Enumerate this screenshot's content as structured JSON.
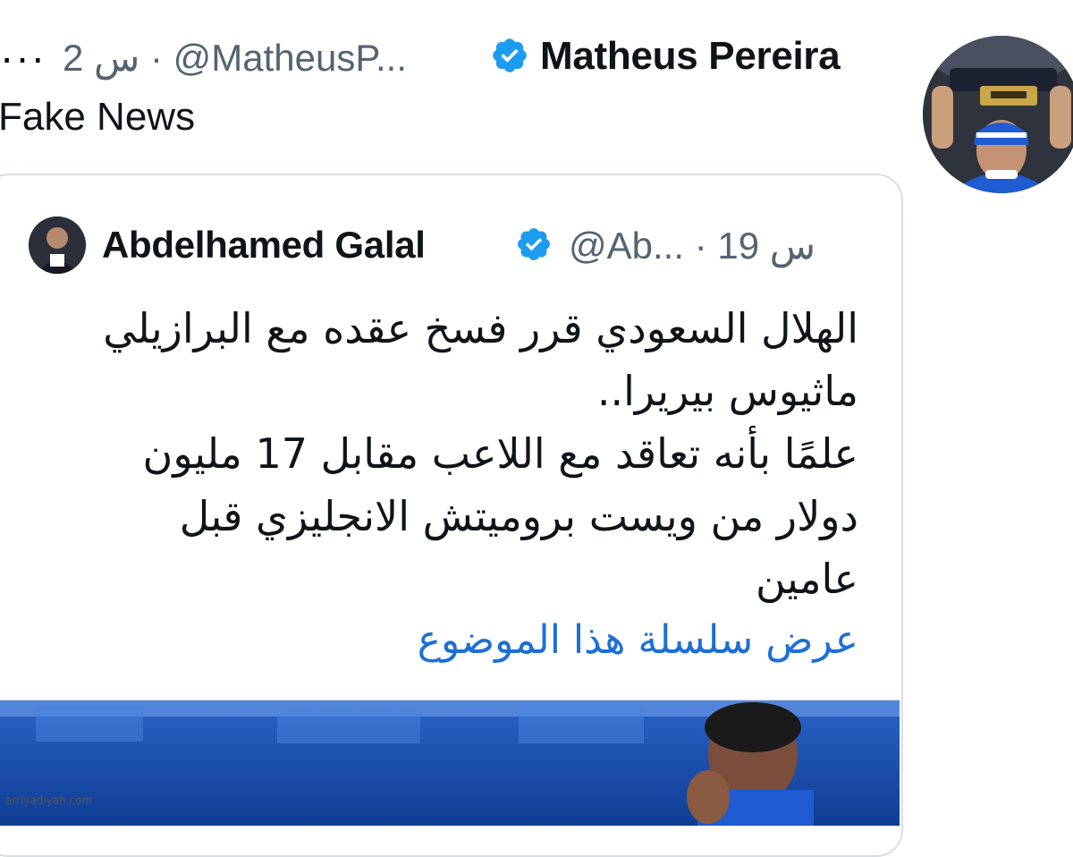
{
  "tweet": {
    "more_label": "···",
    "time_label": "2 س",
    "separator": "·",
    "handle": "@MatheusP...",
    "author_name": "Matheus Pereira",
    "text": "Fake News"
  },
  "quoted_tweet": {
    "author_name": "Abdelhamed Galal",
    "handle": "@Ab...",
    "separator": "·",
    "time_label": "19 س",
    "lines": [
      "الهلال السعودي قرر فسخ عقده مع البرازيلي",
      "ماثيوس بيريرا..",
      "علمًا بأنه تعاقد مع اللاعب مقابل 17 مليون",
      "دولار من ويست بروميتش الانجليزي قبل",
      "عامين"
    ],
    "show_thread": "عرض سلسلة هذا الموضوع"
  },
  "watermark": "arriyadiyah.com",
  "colors": {
    "verified": "#1d9bf0",
    "link": "#1d6fd6",
    "secondary_text": "#536471"
  },
  "icons": {
    "verified": "verified-badge-icon",
    "more": "more-options-icon"
  }
}
